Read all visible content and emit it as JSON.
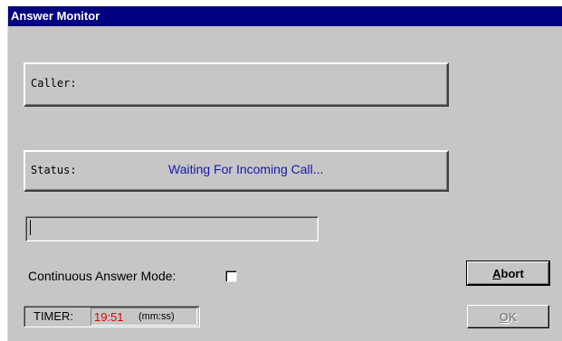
{
  "window": {
    "title": "Answer Monitor"
  },
  "caller": {
    "label": "Caller:",
    "value": ""
  },
  "status": {
    "label": "Status:",
    "value": "Waiting For Incoming Call..."
  },
  "continuous_mode": {
    "label": "Continuous Answer Mode:",
    "checked": false
  },
  "buttons": {
    "abort": "Abort",
    "abort_mnemonic": "A",
    "ok": "OK",
    "ok_mnemonic": "O"
  },
  "timer": {
    "label": "TIMER:",
    "value": "19:51",
    "units": "(mm:ss)"
  },
  "colors": {
    "titlebar": "#000080",
    "status_text": "#1818b0",
    "timer_value": "#e00000"
  }
}
